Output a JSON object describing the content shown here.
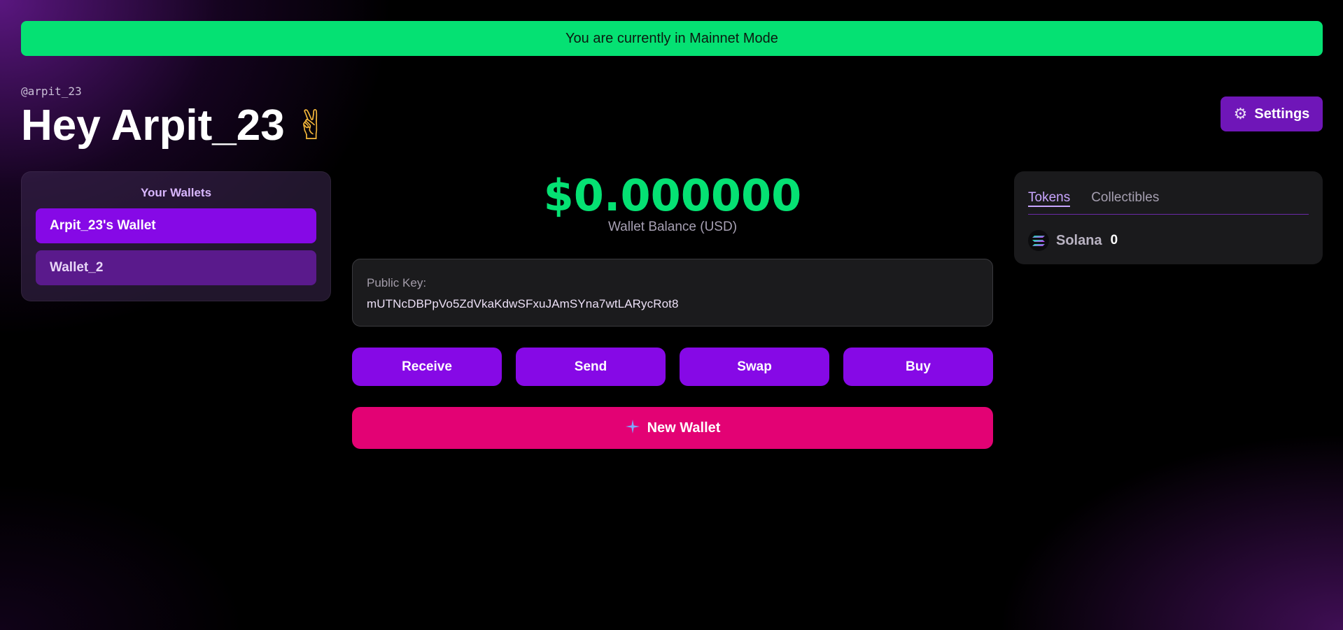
{
  "banner": {
    "text": "You are currently in Mainnet Mode"
  },
  "header": {
    "handle": "@arpit_23",
    "greeting": "Hey Arpit_23",
    "greeting_emoji": "✌",
    "settings_label": "Settings",
    "settings_icon": "gear-icon"
  },
  "wallets": {
    "title": "Your Wallets",
    "items": [
      {
        "label": "Arpit_23's Wallet",
        "active": true
      },
      {
        "label": "Wallet_2",
        "active": false
      }
    ]
  },
  "balance": {
    "amount": "$0.000000",
    "label": "Wallet Balance (USD)"
  },
  "public_key": {
    "label": "Public Key:",
    "value": "mUTNcDBPpVo5ZdVkaKdwSFxuJAmSYna7wtLARycRot8"
  },
  "actions": {
    "receive": "Receive",
    "send": "Send",
    "swap": "Swap",
    "buy": "Buy"
  },
  "new_wallet": {
    "label": "New Wallet",
    "icon": "sparkle-icon"
  },
  "tokens_panel": {
    "tabs": [
      {
        "label": "Tokens",
        "active": true
      },
      {
        "label": "Collectibles",
        "active": false
      }
    ],
    "tokens": [
      {
        "name": "Solana",
        "amount": "0",
        "icon": "solana-icon"
      }
    ]
  },
  "colors": {
    "accent_green": "#05e173",
    "accent_purple": "#8609e6",
    "accent_pink": "#e30274",
    "settings_purple": "#6f16b8"
  }
}
